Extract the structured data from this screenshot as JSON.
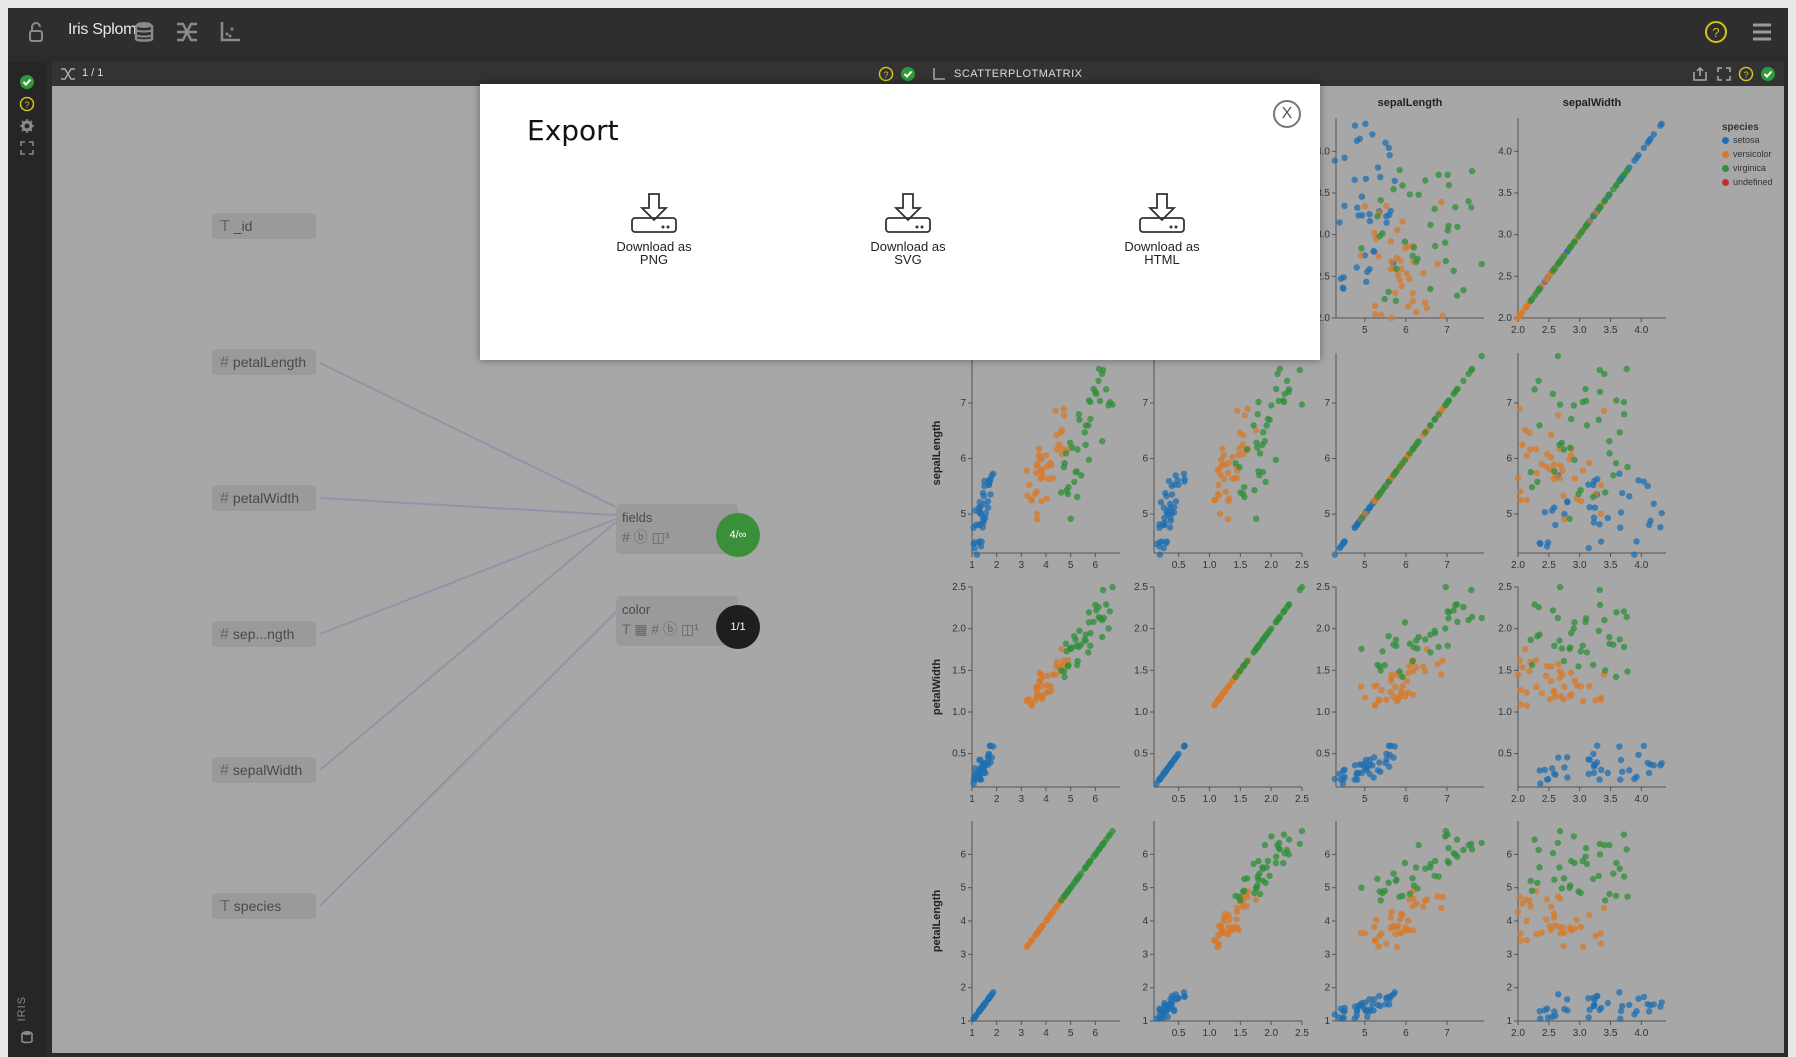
{
  "app": {
    "title": "Iris Splom"
  },
  "left_panel": {
    "counter": "1 / 1"
  },
  "right_panel": {
    "title": "SCATTERPLOTMATRIX"
  },
  "rail": {
    "label": "IRIS"
  },
  "fields": [
    {
      "type": "T",
      "label": "_id"
    },
    {
      "type": "#",
      "label": "petalLength"
    },
    {
      "type": "#",
      "label": "petalWidth"
    },
    {
      "type": "#",
      "label": "sep...ngth"
    },
    {
      "type": "#",
      "label": "sepalWidth"
    },
    {
      "type": "T",
      "label": "species"
    }
  ],
  "targets": [
    {
      "label": "fields",
      "symbols": "# ⓑ ◫³",
      "badge": "4/∞",
      "badge_color": "#3a8f3a"
    },
    {
      "label": "color",
      "symbols": "T ▦ # ⓑ ◫¹",
      "badge": "1/1",
      "badge_color": "#1e1e1e"
    }
  ],
  "modal": {
    "title": "Export",
    "close_label": "X",
    "options": [
      {
        "line1": "Download as",
        "line2": "PNG"
      },
      {
        "line1": "Download as",
        "line2": "SVG"
      },
      {
        "line1": "Download as",
        "line2": "HTML"
      }
    ]
  },
  "colors": {
    "setosa": "#1f6fb0",
    "versicolor": "#d8792a",
    "virginica": "#2f8f3a",
    "undefined": "#c0302a",
    "accent_green": "#3a8f3a",
    "accent_yellow": "#d4c41a"
  },
  "chart_data": {
    "type": "scatter",
    "variables": [
      "petalLength",
      "petalWidth",
      "sepalLength",
      "sepalWidth"
    ],
    "column_headers": [
      "sepalLength",
      "sepalWidth"
    ],
    "row_labels": [
      "sepalLength",
      "petalWidth",
      "petalLength"
    ],
    "ticks": {
      "petalLength": [
        "1",
        "2",
        "3",
        "4",
        "5",
        "6"
      ],
      "petalWidth": [
        "0.5",
        "1.0",
        "1.5",
        "2.0",
        "2.5"
      ],
      "sepalLength": [
        "5",
        "6",
        "7"
      ],
      "sepalWidth": [
        "2.0",
        "2.5",
        "3.0",
        "3.5",
        "4.0"
      ]
    },
    "ranges": {
      "petalLength": [
        1,
        7
      ],
      "petalWidth": [
        0.1,
        2.5
      ],
      "sepalLength": [
        4.3,
        7.9
      ],
      "sepalWidth": [
        2.0,
        4.4
      ]
    },
    "legend": {
      "title": "species",
      "items": [
        "setosa",
        "versicolor",
        "virginica",
        "undefined"
      ],
      "placement": "top-right"
    },
    "clusters": {
      "setosa": {
        "petalLength": [
          1.0,
          1.9
        ],
        "petalWidth": [
          0.1,
          0.6
        ],
        "sepalLength": [
          4.3,
          5.8
        ],
        "sepalWidth": [
          2.3,
          4.4
        ]
      },
      "versicolor": {
        "petalLength": [
          3.0,
          5.1
        ],
        "petalWidth": [
          1.0,
          1.8
        ],
        "sepalLength": [
          4.9,
          7.0
        ],
        "sepalWidth": [
          2.0,
          3.4
        ]
      },
      "virginica": {
        "petalLength": [
          4.5,
          6.9
        ],
        "petalWidth": [
          1.4,
          2.5
        ],
        "sepalLength": [
          4.9,
          7.9
        ],
        "sepalWidth": [
          2.2,
          3.8
        ]
      }
    }
  }
}
